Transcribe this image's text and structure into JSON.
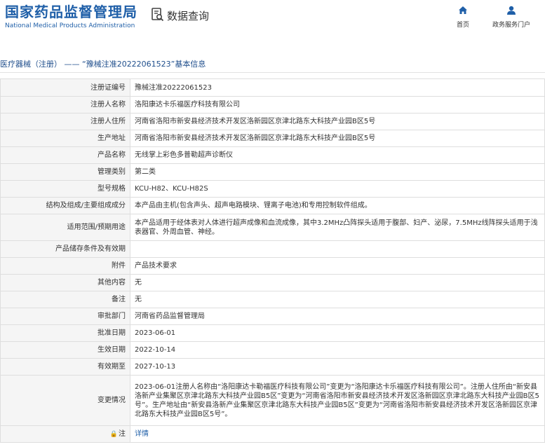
{
  "header": {
    "logo_cn": "国家药品监督管理局",
    "logo_en": "National Medical Products Administration",
    "query_label": "数据查询",
    "nav": {
      "home_label": "首页",
      "gov_label": "政务服务门户"
    }
  },
  "breadcrumb": "医疗器械（注册） —— “豫械注准20222061523”基本信息",
  "rows": [
    {
      "label": "注册证编号",
      "value": "豫械注准20222061523"
    },
    {
      "label": "注册人名称",
      "value": "洛阳康达卡乐福医疗科技有限公司"
    },
    {
      "label": "注册人住所",
      "value": "河南省洛阳市新安县经济技术开发区洛新园区京津北路东大科技产业园B区5号"
    },
    {
      "label": "生产地址",
      "value": "河南省洛阳市新安县经济技术开发区洛新园区京津北路东大科技产业园B区5号"
    },
    {
      "label": "产品名称",
      "value": "无线掌上彩色多普勒超声诊断仪"
    },
    {
      "label": "管理类别",
      "value": "第二类"
    },
    {
      "label": "型号规格",
      "value": "KCU-H82、KCU-H82S"
    },
    {
      "label": "结构及组成/主要组成成分",
      "value": "本产品由主机(包含声头、超声电路模块、锂离子电池)和专用控制软件组成。"
    },
    {
      "label": "适用范围/预期用途",
      "value": "本产品适用于经体表对人体进行超声成像和血流成像，其中3.2MHz凸阵探头适用于腹部、妇产、泌尿，7.5MHz线阵探头适用于浅表器官、外周血管、神经。"
    },
    {
      "label": "产品储存条件及有效期",
      "value": ""
    },
    {
      "label": "附件",
      "value": "产品技术要求"
    },
    {
      "label": "其他内容",
      "value": "无"
    },
    {
      "label": "备注",
      "value": "无"
    },
    {
      "label": "审批部门",
      "value": "河南省药品监督管理局"
    },
    {
      "label": "批准日期",
      "value": "2023-06-01"
    },
    {
      "label": "生效日期",
      "value": "2022-10-14"
    },
    {
      "label": "有效期至",
      "value": "2027-10-13"
    },
    {
      "label": "变更情况",
      "value": "2023-06-01注册人名称由“洛阳康达卡勒福医疗科技有限公司”变更为“洛阳康达卡乐福医疗科技有限公司”。注册人住所由“新安县洛新产业集聚区京津北路东大科技产业园B5区”变更为“河南省洛阳市新安县经济技术开发区洛新园区京津北路东大科技产业园B区5号”。生产地址由“新安县洛新产业集聚区京津北路东大科技产业园B5区”变更为“河南省洛阳市新安县经济技术开发区洛新园区京津北路东大科技产业园B区5号”。"
    }
  ],
  "note_row": {
    "label": "注",
    "link": "详情"
  },
  "colors": {
    "brand": "#1f5fa8",
    "label_bg": "#f5f5f5",
    "border": "#dedede"
  },
  "icons": {
    "query": "doc-search-icon",
    "home": "home-icon",
    "gov": "user-icon",
    "note": "lock-icon"
  }
}
